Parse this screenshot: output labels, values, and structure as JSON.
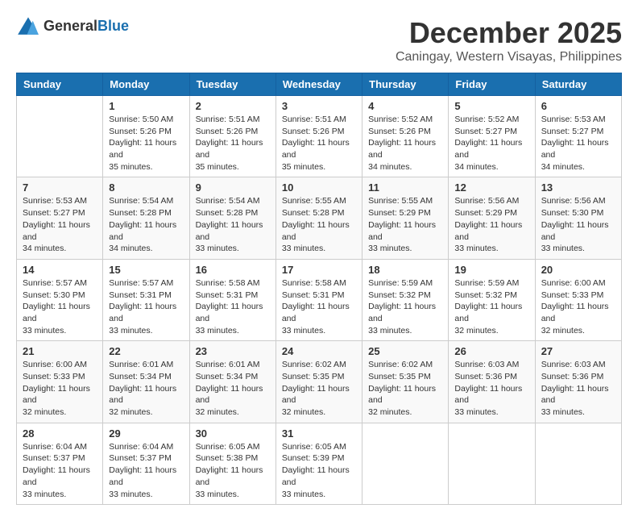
{
  "header": {
    "logo_general": "General",
    "logo_blue": "Blue",
    "month": "December 2025",
    "location": "Caningay, Western Visayas, Philippines"
  },
  "weekdays": [
    "Sunday",
    "Monday",
    "Tuesday",
    "Wednesday",
    "Thursday",
    "Friday",
    "Saturday"
  ],
  "weeks": [
    [
      {
        "day": "",
        "sunrise": "",
        "sunset": "",
        "daylight": ""
      },
      {
        "day": "1",
        "sunrise": "Sunrise: 5:50 AM",
        "sunset": "Sunset: 5:26 PM",
        "daylight": "Daylight: 11 hours and 35 minutes."
      },
      {
        "day": "2",
        "sunrise": "Sunrise: 5:51 AM",
        "sunset": "Sunset: 5:26 PM",
        "daylight": "Daylight: 11 hours and 35 minutes."
      },
      {
        "day": "3",
        "sunrise": "Sunrise: 5:51 AM",
        "sunset": "Sunset: 5:26 PM",
        "daylight": "Daylight: 11 hours and 35 minutes."
      },
      {
        "day": "4",
        "sunrise": "Sunrise: 5:52 AM",
        "sunset": "Sunset: 5:26 PM",
        "daylight": "Daylight: 11 hours and 34 minutes."
      },
      {
        "day": "5",
        "sunrise": "Sunrise: 5:52 AM",
        "sunset": "Sunset: 5:27 PM",
        "daylight": "Daylight: 11 hours and 34 minutes."
      },
      {
        "day": "6",
        "sunrise": "Sunrise: 5:53 AM",
        "sunset": "Sunset: 5:27 PM",
        "daylight": "Daylight: 11 hours and 34 minutes."
      }
    ],
    [
      {
        "day": "7",
        "sunrise": "Sunrise: 5:53 AM",
        "sunset": "Sunset: 5:27 PM",
        "daylight": "Daylight: 11 hours and 34 minutes."
      },
      {
        "day": "8",
        "sunrise": "Sunrise: 5:54 AM",
        "sunset": "Sunset: 5:28 PM",
        "daylight": "Daylight: 11 hours and 34 minutes."
      },
      {
        "day": "9",
        "sunrise": "Sunrise: 5:54 AM",
        "sunset": "Sunset: 5:28 PM",
        "daylight": "Daylight: 11 hours and 33 minutes."
      },
      {
        "day": "10",
        "sunrise": "Sunrise: 5:55 AM",
        "sunset": "Sunset: 5:28 PM",
        "daylight": "Daylight: 11 hours and 33 minutes."
      },
      {
        "day": "11",
        "sunrise": "Sunrise: 5:55 AM",
        "sunset": "Sunset: 5:29 PM",
        "daylight": "Daylight: 11 hours and 33 minutes."
      },
      {
        "day": "12",
        "sunrise": "Sunrise: 5:56 AM",
        "sunset": "Sunset: 5:29 PM",
        "daylight": "Daylight: 11 hours and 33 minutes."
      },
      {
        "day": "13",
        "sunrise": "Sunrise: 5:56 AM",
        "sunset": "Sunset: 5:30 PM",
        "daylight": "Daylight: 11 hours and 33 minutes."
      }
    ],
    [
      {
        "day": "14",
        "sunrise": "Sunrise: 5:57 AM",
        "sunset": "Sunset: 5:30 PM",
        "daylight": "Daylight: 11 hours and 33 minutes."
      },
      {
        "day": "15",
        "sunrise": "Sunrise: 5:57 AM",
        "sunset": "Sunset: 5:31 PM",
        "daylight": "Daylight: 11 hours and 33 minutes."
      },
      {
        "day": "16",
        "sunrise": "Sunrise: 5:58 AM",
        "sunset": "Sunset: 5:31 PM",
        "daylight": "Daylight: 11 hours and 33 minutes."
      },
      {
        "day": "17",
        "sunrise": "Sunrise: 5:58 AM",
        "sunset": "Sunset: 5:31 PM",
        "daylight": "Daylight: 11 hours and 33 minutes."
      },
      {
        "day": "18",
        "sunrise": "Sunrise: 5:59 AM",
        "sunset": "Sunset: 5:32 PM",
        "daylight": "Daylight: 11 hours and 33 minutes."
      },
      {
        "day": "19",
        "sunrise": "Sunrise: 5:59 AM",
        "sunset": "Sunset: 5:32 PM",
        "daylight": "Daylight: 11 hours and 32 minutes."
      },
      {
        "day": "20",
        "sunrise": "Sunrise: 6:00 AM",
        "sunset": "Sunset: 5:33 PM",
        "daylight": "Daylight: 11 hours and 32 minutes."
      }
    ],
    [
      {
        "day": "21",
        "sunrise": "Sunrise: 6:00 AM",
        "sunset": "Sunset: 5:33 PM",
        "daylight": "Daylight: 11 hours and 32 minutes."
      },
      {
        "day": "22",
        "sunrise": "Sunrise: 6:01 AM",
        "sunset": "Sunset: 5:34 PM",
        "daylight": "Daylight: 11 hours and 32 minutes."
      },
      {
        "day": "23",
        "sunrise": "Sunrise: 6:01 AM",
        "sunset": "Sunset: 5:34 PM",
        "daylight": "Daylight: 11 hours and 32 minutes."
      },
      {
        "day": "24",
        "sunrise": "Sunrise: 6:02 AM",
        "sunset": "Sunset: 5:35 PM",
        "daylight": "Daylight: 11 hours and 32 minutes."
      },
      {
        "day": "25",
        "sunrise": "Sunrise: 6:02 AM",
        "sunset": "Sunset: 5:35 PM",
        "daylight": "Daylight: 11 hours and 32 minutes."
      },
      {
        "day": "26",
        "sunrise": "Sunrise: 6:03 AM",
        "sunset": "Sunset: 5:36 PM",
        "daylight": "Daylight: 11 hours and 33 minutes."
      },
      {
        "day": "27",
        "sunrise": "Sunrise: 6:03 AM",
        "sunset": "Sunset: 5:36 PM",
        "daylight": "Daylight: 11 hours and 33 minutes."
      }
    ],
    [
      {
        "day": "28",
        "sunrise": "Sunrise: 6:04 AM",
        "sunset": "Sunset: 5:37 PM",
        "daylight": "Daylight: 11 hours and 33 minutes."
      },
      {
        "day": "29",
        "sunrise": "Sunrise: 6:04 AM",
        "sunset": "Sunset: 5:37 PM",
        "daylight": "Daylight: 11 hours and 33 minutes."
      },
      {
        "day": "30",
        "sunrise": "Sunrise: 6:05 AM",
        "sunset": "Sunset: 5:38 PM",
        "daylight": "Daylight: 11 hours and 33 minutes."
      },
      {
        "day": "31",
        "sunrise": "Sunrise: 6:05 AM",
        "sunset": "Sunset: 5:39 PM",
        "daylight": "Daylight: 11 hours and 33 minutes."
      },
      {
        "day": "",
        "sunrise": "",
        "sunset": "",
        "daylight": ""
      },
      {
        "day": "",
        "sunrise": "",
        "sunset": "",
        "daylight": ""
      },
      {
        "day": "",
        "sunrise": "",
        "sunset": "",
        "daylight": ""
      }
    ]
  ]
}
